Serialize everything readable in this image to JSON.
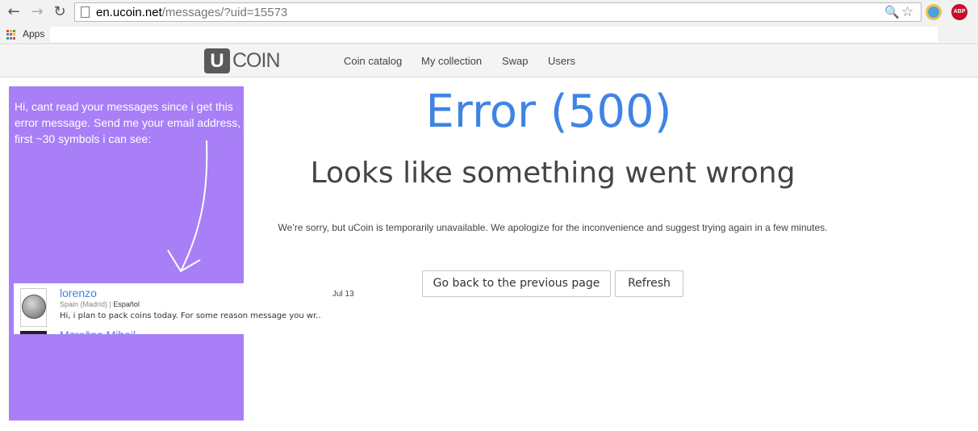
{
  "browser": {
    "url_domain": "en.ucoin.net",
    "url_path": "/messages/?uid=15573",
    "back_icon": "←",
    "forward_icon": "→",
    "reload_icon": "↻",
    "zoom_icon": "🔍",
    "star_icon": "☆",
    "abp_label": "ABP",
    "apps_label": "Apps"
  },
  "site": {
    "logo_letter": "U",
    "logo_text": "COIN",
    "nav": [
      "Coin catalog",
      "My collection",
      "Swap",
      "Users"
    ]
  },
  "error": {
    "title": "Error (500)",
    "subtitle": "Looks like something went wrong",
    "message": "We’re sorry, but uCoin is temporarily unavailable. We apologize for the inconvenience and suggest trying again in a few minutes.",
    "back_button": "Go back to the previous page",
    "refresh_button": "Refresh"
  },
  "annotation": {
    "text": "Hi, cant read your messages since i get this error message. Send me your email address, first ~30 symbols i can see:"
  },
  "message_preview": {
    "sender": "lorenzo",
    "location": "Spain (Madrid)",
    "separator": " | ",
    "language": "Español",
    "date": "Jul 13",
    "snippet": "Hi, i plan to pack coins today. For some reason message you wr..",
    "next_sender_partial": "Mzrožna Mihail"
  },
  "colors": {
    "accent_blue": "#3f84e5",
    "annotation_purple": "#a87ff7",
    "abp_red": "#c70d2c"
  }
}
